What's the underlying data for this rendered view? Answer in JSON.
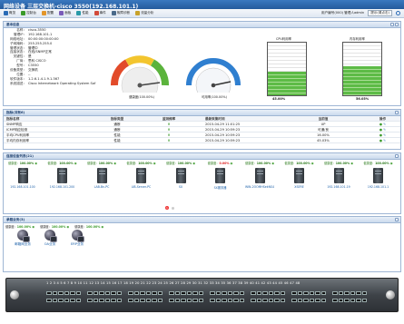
{
  "window": {
    "title": "网络设备 三层交换机-cisco 3550(192.168.101.1)"
  },
  "toolbar": {
    "items": [
      "概览",
      "控制台",
      "配置",
      "面板",
      "性能",
      "事件",
      "故障诊断",
      "流量分析"
    ],
    "user_text": "用户编号(000) 管理人admin",
    "notify_label": "提示(请点击)"
  },
  "basic": {
    "title": "基本信息",
    "fields": [
      {
        "k": "名称：",
        "v": "cisco-3550"
      },
      {
        "k": "管理IP：",
        "v": "192.168.101.1"
      },
      {
        "k": "网络地址：",
        "v": "00:00:00:00:00:00"
      },
      {
        "k": "子网掩码：",
        "v": "255.255.255.0"
      },
      {
        "k": "管理状态：",
        "v": "管理中"
      },
      {
        "k": "连接状态：",
        "v": "在线/SNMP正常"
      },
      {
        "k": "关键性：",
        "v": "是"
      },
      {
        "k": "厂商：",
        "v": "思科 CISCO"
      },
      {
        "k": "型号：",
        "v": "C3550"
      },
      {
        "k": "设备类型：",
        "v": "交换机"
      },
      {
        "k": "位置：",
        "v": "--"
      },
      {
        "k": "软件版本：",
        "v": "1.2.6.1.4.1.9.1.367"
      },
      {
        "k": "系统描述：",
        "v": "Cisco Internetwork Operating System Sof"
      }
    ],
    "gauge1_caption": "健康度(100.00%)",
    "gauge2_caption": "可用率(100.00%)",
    "cpu_title": "CPU利用率",
    "mem_title": "内存利用率",
    "cpu_value": "45.00%",
    "mem_value": "56.05%"
  },
  "colors": {
    "accent": "#2a6bb6",
    "ok": "#3a9a2a",
    "bad": "#dd2222"
  },
  "metrics": {
    "title": "指标(共有6)",
    "headers": [
      "指标名称",
      "指标类型",
      "监测频率",
      "最新采集时间",
      "当前值",
      "操作"
    ],
    "rows": [
      [
        "SNMP响应",
        "通断",
        "",
        "2015-04-29 11:01:25",
        "UP",
        ""
      ],
      [
        "ICMP响应检测",
        "通断",
        "",
        "2015-04-29 10:59:23",
        "可通/良",
        ""
      ],
      [
        "平均CPU利用率",
        "性能",
        "",
        "2015-04-29 10:59:23",
        "16.00%",
        ""
      ],
      [
        "平均内存利用率",
        "性能",
        "",
        "2015-04-29 10:59:23",
        "45.03%",
        ""
      ]
    ]
  },
  "connected": {
    "title": "连接设备列表(21)",
    "page_indicator": "1",
    "devices": [
      {
        "status_label": "健康度：",
        "status": "100.00%",
        "bad": false,
        "name": "192.168.101.100"
      },
      {
        "status_label": "健康度：",
        "status": "100.00%",
        "bad": false,
        "name": "192.168.101.200"
      },
      {
        "status_label": "健康度：",
        "status": "100.00%",
        "bad": false,
        "name": "LAB-Bn-PC"
      },
      {
        "status_label": "健康度：",
        "status": "100.00%",
        "bad": false,
        "name": "LIB-Server-PC"
      },
      {
        "status_label": "健康度：",
        "status": "100.00%",
        "bad": false,
        "name": "SX"
      },
      {
        "status_label": "健康度：",
        "status": "0.00%",
        "bad": true,
        "name": "SX服务器"
      },
      {
        "status_label": "健康度：",
        "status": "100.00%",
        "bad": false,
        "name": "WIN-2OOMHSekNS4"
      },
      {
        "status_label": "健康度：",
        "status": "100.00%",
        "bad": false,
        "name": "XSERE"
      },
      {
        "status_label": "健康度：",
        "status": "100.00%",
        "bad": false,
        "name": "192.168.101.19"
      },
      {
        "status_label": "健康度：",
        "status": "100.00%",
        "bad": false,
        "name": "192.168.101.1"
      }
    ]
  },
  "services": {
    "title": "承载业务(3)",
    "items": [
      {
        "status_label": "健康度：",
        "status": "100.00%",
        "name": "邮箱网业务"
      },
      {
        "status_label": "健康度：",
        "status": "100.00%",
        "name": "OA业务"
      },
      {
        "status_label": "健康度：",
        "status": "100.00%",
        "name": "ERP业务"
      }
    ]
  },
  "panel": {
    "port_numbers": "1 2 3 4 5 6 7 8 9 10 11 12 13 14 15 16 17 18 19 20 21 22 23 24 25 26 27 28 29 30 31 32 33 34 35 36 37 38 39 40 41 42 43 44 45 46 47 48"
  }
}
